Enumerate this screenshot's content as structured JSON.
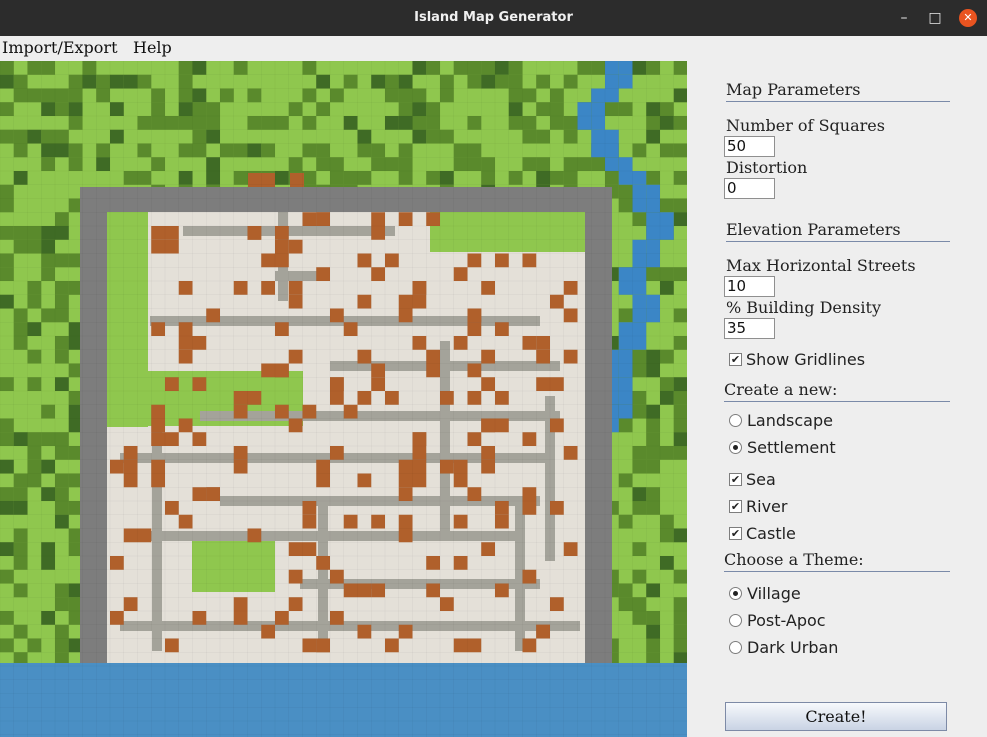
{
  "window": {
    "title": "Island Map Generator",
    "minimize_glyph": "–",
    "maximize_glyph": "□",
    "close_glyph": "✕"
  },
  "menu": {
    "items": [
      "Import/Export",
      "Help"
    ]
  },
  "panel": {
    "map_parameters": {
      "title": "Map Parameters",
      "number_of_squares_label": "Number of Squares",
      "number_of_squares_value": "50",
      "distortion_label": "Distortion",
      "distortion_value": "0"
    },
    "elevation_parameters": {
      "title": "Elevation Parameters",
      "max_horizontal_streets_label": "Max Horizontal Streets",
      "max_horizontal_streets_value": "10",
      "building_density_label": "% Building Density",
      "building_density_value": "35",
      "show_gridlines_label": "Show Gridlines",
      "show_gridlines_checked": true
    },
    "create_new": {
      "title": "Create a new:",
      "options": [
        {
          "label": "Landscape",
          "selected": false
        },
        {
          "label": "Settlement",
          "selected": true
        }
      ],
      "features": [
        {
          "label": "Sea",
          "checked": true
        },
        {
          "label": "River",
          "checked": true
        },
        {
          "label": "Castle",
          "checked": true
        }
      ]
    },
    "theme": {
      "title": "Choose a Theme:",
      "options": [
        {
          "label": "Village",
          "selected": true
        },
        {
          "label": "Post-Apoc",
          "selected": false
        },
        {
          "label": "Dark Urban",
          "selected": false
        }
      ]
    },
    "create_button": "Create!"
  },
  "map": {
    "grid_squares": 50,
    "show_gridlines": true,
    "colors": {
      "grass_light": "#8fc74e",
      "grass_dark": "#5a8a2c",
      "forest": "#3f6b25",
      "wall": "#7d7d7d",
      "plaza": "#e4e0d8",
      "street": "#a4a39a",
      "roof": "#b0602b",
      "water": "#4a8fc4",
      "river": "#3b86c6"
    }
  }
}
